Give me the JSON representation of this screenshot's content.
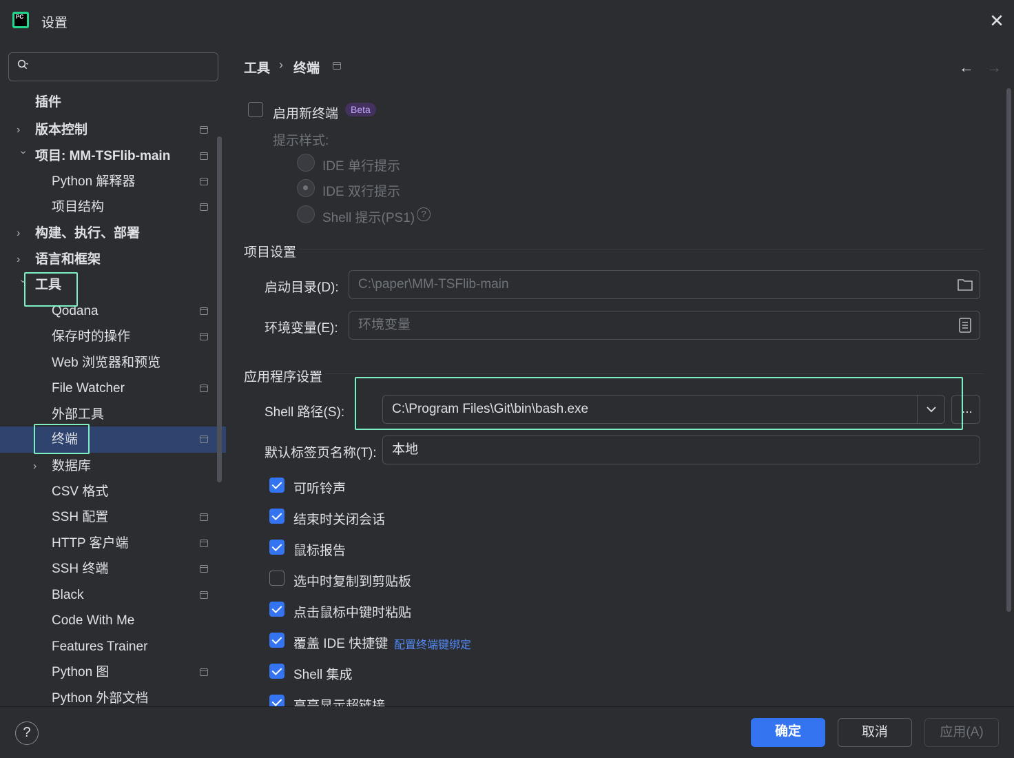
{
  "window": {
    "title": "设置",
    "logo_text": "PC"
  },
  "search": {
    "placeholder": ""
  },
  "sidebar": {
    "items": [
      {
        "label": "插件"
      },
      {
        "label": "版本控制"
      },
      {
        "label": "项目: MM-TSFlib-main"
      },
      {
        "label": "Python 解释器"
      },
      {
        "label": "项目结构"
      },
      {
        "label": "构建、执行、部署"
      },
      {
        "label": "语言和框架"
      },
      {
        "label": "工具"
      },
      {
        "label": "Qodana"
      },
      {
        "label": "保存时的操作"
      },
      {
        "label": "Web 浏览器和预览"
      },
      {
        "label": "File Watcher"
      },
      {
        "label": "外部工具"
      },
      {
        "label": "终端"
      },
      {
        "label": "数据库"
      },
      {
        "label": "CSV 格式"
      },
      {
        "label": "SSH 配置"
      },
      {
        "label": "HTTP 客户端"
      },
      {
        "label": "SSH 终端"
      },
      {
        "label": "Black"
      },
      {
        "label": "Code With Me"
      },
      {
        "label": "Features Trainer"
      },
      {
        "label": "Python 图"
      },
      {
        "label": "Python 外部文档"
      }
    ]
  },
  "breadcrumb": {
    "parent": "工具",
    "current": "终端"
  },
  "terminal": {
    "new_terminal_label": "启用新终端",
    "beta_badge": "Beta",
    "prompt_style_label": "提示样式:",
    "prompt_options": [
      "IDE 单行提示",
      "IDE 双行提示",
      "Shell 提示(PS1)"
    ],
    "project_section": "项目设置",
    "start_dir_label": "启动目录(D):",
    "start_dir_value": "C:\\paper\\MM-TSFlib-main",
    "env_label": "环境变量(E):",
    "env_placeholder": "环境变量",
    "app_section": "应用程序设置",
    "shell_path_label": "Shell 路径(S):",
    "shell_path_value": "C:\\Program Files\\Git\\bin\\bash.exe",
    "browse_label": "...",
    "tab_name_label": "默认标签页名称(T):",
    "tab_name_value": "本地",
    "options": [
      {
        "label": "可听铃声",
        "checked": true
      },
      {
        "label": "结束时关闭会话",
        "checked": true
      },
      {
        "label": "鼠标报告",
        "checked": true
      },
      {
        "label": "选中时复制到剪贴板",
        "checked": false
      },
      {
        "label": "点击鼠标中键时粘贴",
        "checked": true
      },
      {
        "label": "覆盖 IDE 快捷键",
        "checked": true
      },
      {
        "label": "Shell 集成",
        "checked": true
      },
      {
        "label": "高亮显示超链接",
        "checked": true
      }
    ],
    "keybinding_link": "配置终端键绑定"
  },
  "footer": {
    "help": "?",
    "ok": "确定",
    "cancel": "取消",
    "apply": "应用(A)"
  },
  "colors": {
    "accent": "#3574f0",
    "highlight_box": "#7cf0c4",
    "selected_row": "#2e436e",
    "background": "#2b2d30"
  }
}
